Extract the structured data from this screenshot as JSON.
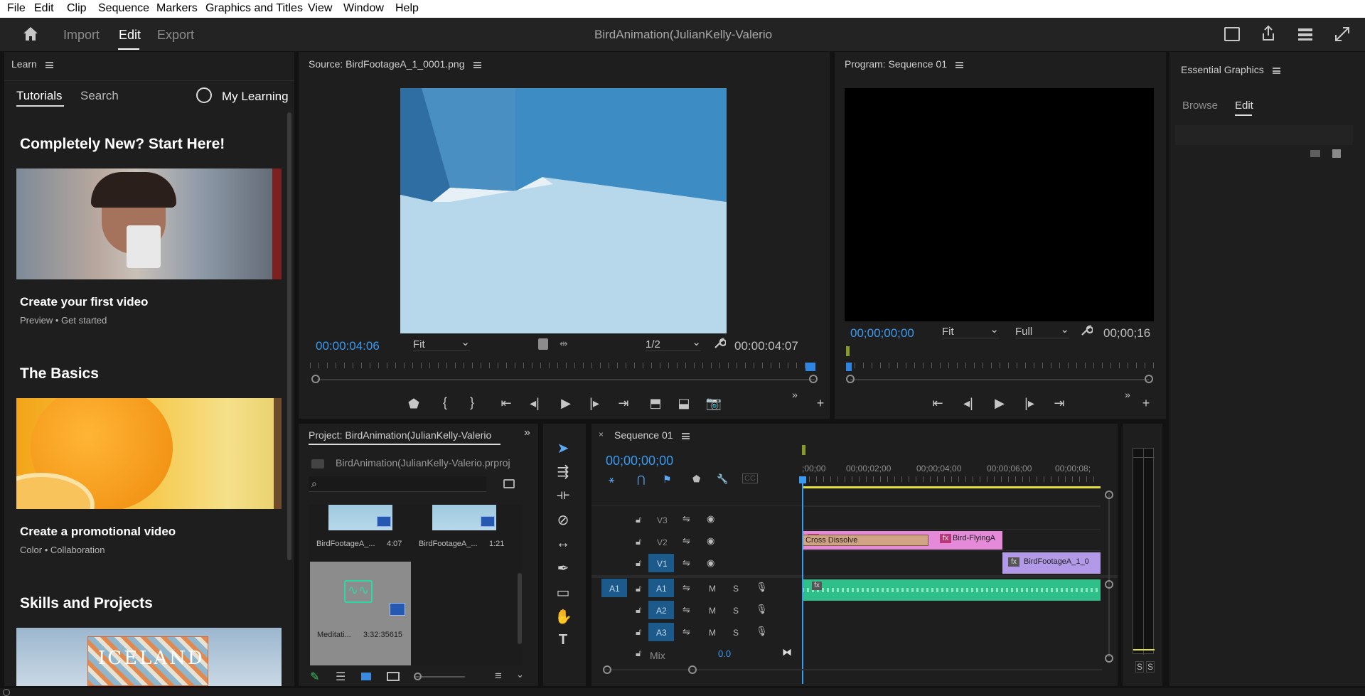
{
  "menu": [
    "File",
    "Edit",
    "Clip",
    "Sequence",
    "Markers",
    "Graphics and Titles",
    "View",
    "Window",
    "Help"
  ],
  "header": {
    "import": "Import",
    "edit": "Edit",
    "export": "Export",
    "project_title": "BirdAnimation(JulianKelly-Valerio"
  },
  "learn": {
    "panel_title": "Learn",
    "tab_tutorials": "Tutorials",
    "tab_search": "Search",
    "my_learning": "My Learning",
    "section1": "Completely New? Start Here!",
    "tut1_title": "Create your first video",
    "tut1_tag1": "Preview",
    "tut1_tag2": "Get started",
    "section2": "The Basics",
    "tut2_title": "Create a promotional video",
    "tut2_tag1": "Color",
    "tut2_tag2": "Collaboration",
    "section3": "Skills and Projects",
    "tut3_text": "ICELAND"
  },
  "source": {
    "title": "Source: BirdFootageA_1_0001.png",
    "timecode": "00:00:04:06",
    "fit": "Fit",
    "resolution": "1/2",
    "duration": "00:00:04:07"
  },
  "program": {
    "title": "Program: Sequence 01",
    "timecode": "00;00;00;00",
    "fit": "Fit",
    "quality": "Full",
    "duration": "00;00;16"
  },
  "graphics": {
    "title": "Essential Graphics",
    "tab_browse": "Browse",
    "tab_edit": "Edit"
  },
  "project": {
    "title": "Project: BirdAnimation(JulianKelly-Valerio",
    "file": "BirdAnimation(JulianKelly-Valerio.prproj",
    "items": [
      {
        "name": "BirdFootageA_...",
        "duration": "4:07"
      },
      {
        "name": "BirdFootageA_...",
        "duration": "1:21"
      },
      {
        "name": "Meditati...",
        "duration": "3:32:35615"
      }
    ]
  },
  "sequence": {
    "title": "Sequence 01",
    "timecode": "00;00;00;00",
    "ruler": [
      ";00;00",
      "00;00;02;00",
      "00;00;04;00",
      "00;00;06;00",
      "00;00;08;"
    ],
    "tracks_video": [
      "V3",
      "V2",
      "V1"
    ],
    "tracks_audio": [
      "A1",
      "A2",
      "A3"
    ],
    "source_patch": "A1",
    "mute": "M",
    "solo": "S",
    "mix_label": "Mix",
    "mix_value": "0.0",
    "clip_transition": "Cross Dissolve",
    "clip_v2": "Bird-FlyingA",
    "clip_v1": "BirdFootageA_1_0",
    "fx": "fx"
  },
  "meter": {
    "s1": "S",
    "s2": "S"
  },
  "colors": {
    "accent": "#3a9af0",
    "clip_pink": "#e58ad8",
    "clip_purple": "#b29ae8",
    "audio_green": "#2fbf8a",
    "yellow": "#e4e040"
  }
}
